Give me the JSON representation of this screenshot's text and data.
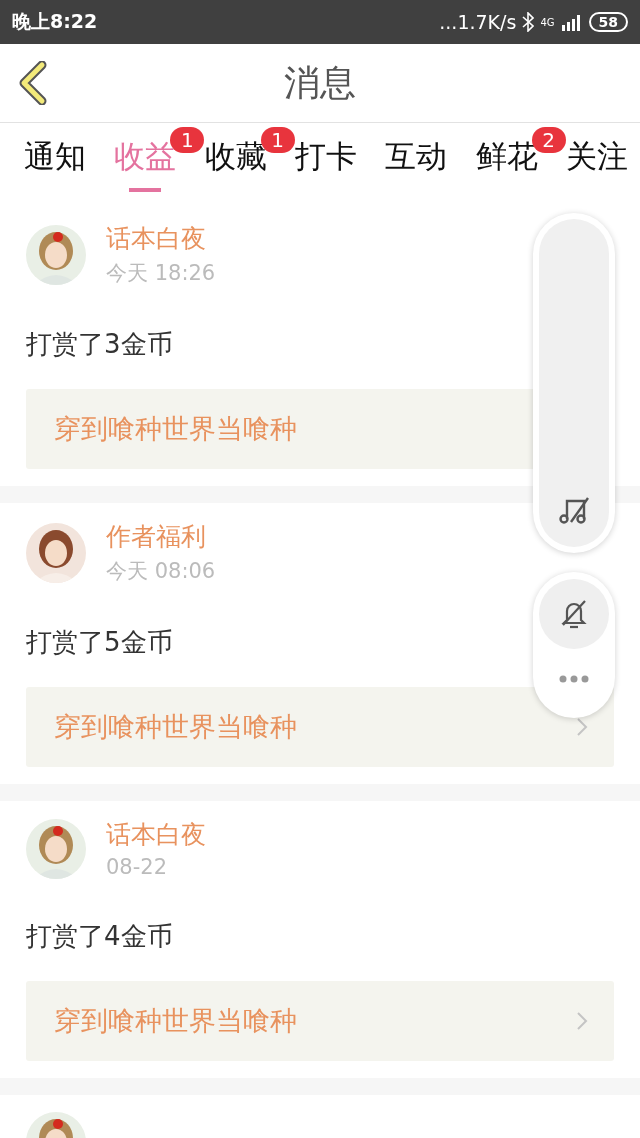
{
  "status_bar": {
    "time": "晚上8:22",
    "speed": "...1.7K/s",
    "network": "4G",
    "battery": "58"
  },
  "header": {
    "title": "消息"
  },
  "tabs": [
    {
      "label": "通知",
      "selected": false
    },
    {
      "label": "收益",
      "selected": true,
      "badge": "1"
    },
    {
      "label": "收藏",
      "selected": false,
      "badge": "1"
    },
    {
      "label": "打卡",
      "selected": false
    },
    {
      "label": "互动",
      "selected": false
    },
    {
      "label": "鲜花",
      "selected": false,
      "badge": "2"
    },
    {
      "label": "关注",
      "selected": false
    }
  ],
  "messages": [
    {
      "name": "话本白夜",
      "time": "今天 18:26",
      "action": "打赏了3金币",
      "book": "穿到喰种世界当喰种"
    },
    {
      "name": "作者福利",
      "time": "今天 08:06",
      "action": "打赏了5金币",
      "book": "穿到喰种世界当喰种"
    },
    {
      "name": "话本白夜",
      "time": "08-22",
      "action": "打赏了4金币",
      "book": "穿到喰种世界当喰种"
    }
  ]
}
